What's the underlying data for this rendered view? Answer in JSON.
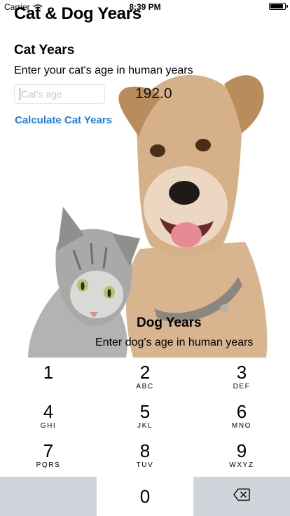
{
  "status_bar": {
    "carrier": "Carrier",
    "time": "8:39 PM",
    "battery_level": 0.9
  },
  "app_title": "Cat & Dog Years",
  "cat": {
    "title": "Cat Years",
    "prompt": "Enter your cat's age in human years",
    "input_placeholder": "Cat's age",
    "result": "192.0",
    "button_label": "Calculate Cat Years"
  },
  "dog": {
    "title": "Dog Years",
    "prompt": "Enter dog's age in human years"
  },
  "keypad": {
    "keys": [
      {
        "num": "1",
        "letters": ""
      },
      {
        "num": "2",
        "letters": "ABC"
      },
      {
        "num": "3",
        "letters": "DEF"
      },
      {
        "num": "4",
        "letters": "GHI"
      },
      {
        "num": "5",
        "letters": "JKL"
      },
      {
        "num": "6",
        "letters": "MNO"
      },
      {
        "num": "7",
        "letters": "PQRS"
      },
      {
        "num": "8",
        "letters": "TUV"
      },
      {
        "num": "9",
        "letters": "WXYZ"
      },
      {
        "num": "0",
        "letters": ""
      }
    ],
    "delete_icon": "backspace-icon"
  },
  "colors": {
    "accent": "#1f7df2",
    "keypad_dark": "#d1d5db"
  }
}
